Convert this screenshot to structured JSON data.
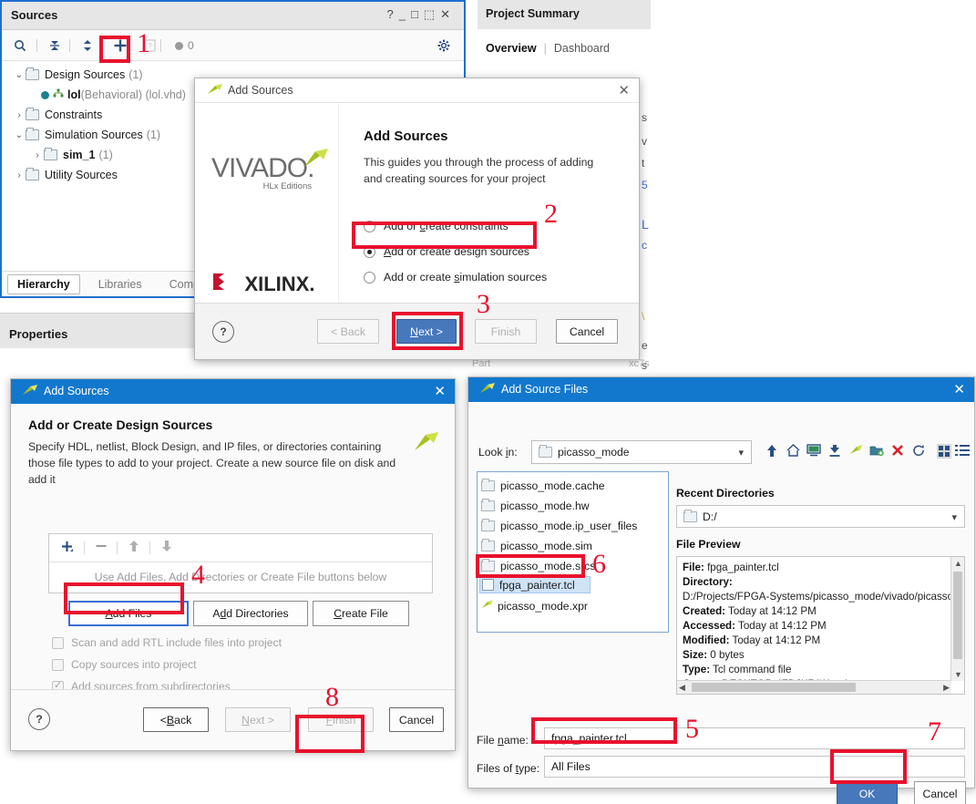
{
  "sources_panel": {
    "title": "Sources",
    "window_controls": [
      "?",
      "_",
      "□",
      "⬚",
      "✕"
    ],
    "toolbar": {
      "search_icon": "search-icon",
      "collapse_icon": "collapse-all-icon",
      "expand_icon": "expand-all-icon",
      "add_icon": "add-sources-icon",
      "report_icon": "report-icon",
      "badge_count": "0",
      "settings_icon": "gear-icon"
    },
    "tree": [
      {
        "arrow": "⌄",
        "label": "Design Sources",
        "count": "(1)",
        "indent": 0
      },
      {
        "label": "lol",
        "meta": "(Behavioral) (lol.vhd)",
        "indent": 1,
        "type": "vhdl"
      },
      {
        "arrow": "›",
        "label": "Constraints",
        "count": "",
        "indent": 0
      },
      {
        "arrow": "⌄",
        "label": "Simulation Sources",
        "count": "(1)",
        "indent": 0
      },
      {
        "arrow": "›",
        "label": "sim_1",
        "count": "(1)",
        "indent": 1
      },
      {
        "arrow": "›",
        "label": "Utility Sources",
        "count": "",
        "indent": 0
      }
    ],
    "tabs": [
      {
        "label": "Hierarchy",
        "active": true
      },
      {
        "label": "Libraries",
        "active": false
      },
      {
        "label": "Compile O",
        "active": false
      }
    ]
  },
  "properties_panel": {
    "title": "Properties"
  },
  "project_summary": {
    "title": "Project Summary",
    "tab_overview": "Overview",
    "tab_divider": "|",
    "tab_dashboard": "Dashboard"
  },
  "background_fragments": {
    "part_label": "Part",
    "part_value": "xc7s"
  },
  "add_sources_dialog": {
    "titlebar": "Add Sources",
    "close_icon": "close-icon",
    "vivado_wordmark": "VIVADO.",
    "vivado_sub": "HLx Editions",
    "xilinx_wordmark": "XILINX.",
    "heading": "Add Sources",
    "description": "This guides you through the process of adding and creating sources for your project",
    "options": [
      {
        "label_pre": "Add or ",
        "label_ul": "c",
        "label_post": "reate constraints",
        "checked": false
      },
      {
        "label_pre": "",
        "label_ul": "A",
        "label_post": "dd or create design sources",
        "checked": true
      },
      {
        "label_pre": "Add or create ",
        "label_ul": "s",
        "label_post": "imulation sources",
        "checked": false
      }
    ],
    "help_label": "?",
    "buttons": {
      "back": "< Back",
      "next": "Next >",
      "finish": "Finish",
      "cancel": "Cancel"
    }
  },
  "create_design_dialog": {
    "titlebar": "Add Sources",
    "close_icon": "close-icon",
    "heading": "Add or Create Design Sources",
    "description": "Specify HDL, netlist, Block Design, and IP files, or directories containing those file types to add to your project. Create a new source file on disk and add it",
    "filebox": {
      "add_icon": "plus-icon",
      "remove_icon": "minus-icon",
      "move_up_icon": "arrow-up-icon",
      "move_down_icon": "arrow-down-icon",
      "empty_text": "Use Add Files, Add Directories or Create File buttons below"
    },
    "buttons_row": {
      "add_files": "Add Files",
      "add_directories": "Add Directories",
      "create_file": "Create File"
    },
    "checkboxes": [
      {
        "label": "Scan and add RTL include files into project",
        "checked": false
      },
      {
        "label": "Copy sources into project",
        "checked": false
      },
      {
        "label": "Add sources from subdirectories",
        "checked": true
      }
    ],
    "help_label": "?",
    "buttons": {
      "back": "< Back",
      "next": "Next >",
      "finish": "Finish",
      "cancel": "Cancel"
    }
  },
  "add_source_files_dialog": {
    "titlebar": "Add Source Files",
    "close_icon": "close-icon",
    "lookin_label": "Look in:",
    "lookin_value": "picasso_mode",
    "toolbar_icons": [
      "parent-directory-icon",
      "home-icon",
      "desktop-icon",
      "download-icon",
      "vivado-project-icon",
      "new-folder-icon",
      "delete-icon",
      "refresh-icon",
      "grid-view-icon",
      "list-view-icon"
    ],
    "file_list": [
      {
        "name": "picasso_mode.cache",
        "type": "folder",
        "selected": false
      },
      {
        "name": "picasso_mode.hw",
        "type": "folder",
        "selected": false
      },
      {
        "name": "picasso_mode.ip_user_files",
        "type": "folder",
        "selected": false
      },
      {
        "name": "picasso_mode.sim",
        "type": "folder",
        "selected": false
      },
      {
        "name": "picasso_mode.srcs",
        "type": "folder",
        "selected": false
      },
      {
        "name": "fpga_painter.tcl",
        "type": "tcl",
        "selected": true
      },
      {
        "name": "picasso_mode.xpr",
        "type": "xpr",
        "selected": false
      }
    ],
    "recent_directories_label": "Recent Directories",
    "recent_directories_value": "D:/",
    "file_preview_label": "File Preview",
    "preview": [
      {
        "key": "File:",
        "value": " fpga_painter.tcl"
      },
      {
        "key": "Directory:",
        "value": ""
      },
      {
        "key": "",
        "value": "D:/Projects/FPGA-Systems/picasso_mode/vivado/picasso"
      },
      {
        "key": "Created:",
        "value": " Today at 14:12 PM"
      },
      {
        "key": "Accessed:",
        "value": " Today at 14:12 PM"
      },
      {
        "key": "Modified:",
        "value": " Today at 14:12 PM"
      },
      {
        "key": "Size:",
        "value": " 0 bytes"
      },
      {
        "key": "Type:",
        "value": " Tcl command file"
      }
    ],
    "filename_label": "File name:",
    "filename_value": "fpga_painter.tcl",
    "filetype_label": "Files of type:",
    "filetype_value": "All Files",
    "buttons": {
      "ok": "OK",
      "cancel": "Cancel"
    }
  },
  "annotations": {
    "color": "#e8112d",
    "markers": [
      {
        "num": "1"
      },
      {
        "num": "2"
      },
      {
        "num": "3"
      },
      {
        "num": "4"
      },
      {
        "num": "5"
      },
      {
        "num": "6"
      },
      {
        "num": "7"
      },
      {
        "num": "8"
      }
    ]
  }
}
